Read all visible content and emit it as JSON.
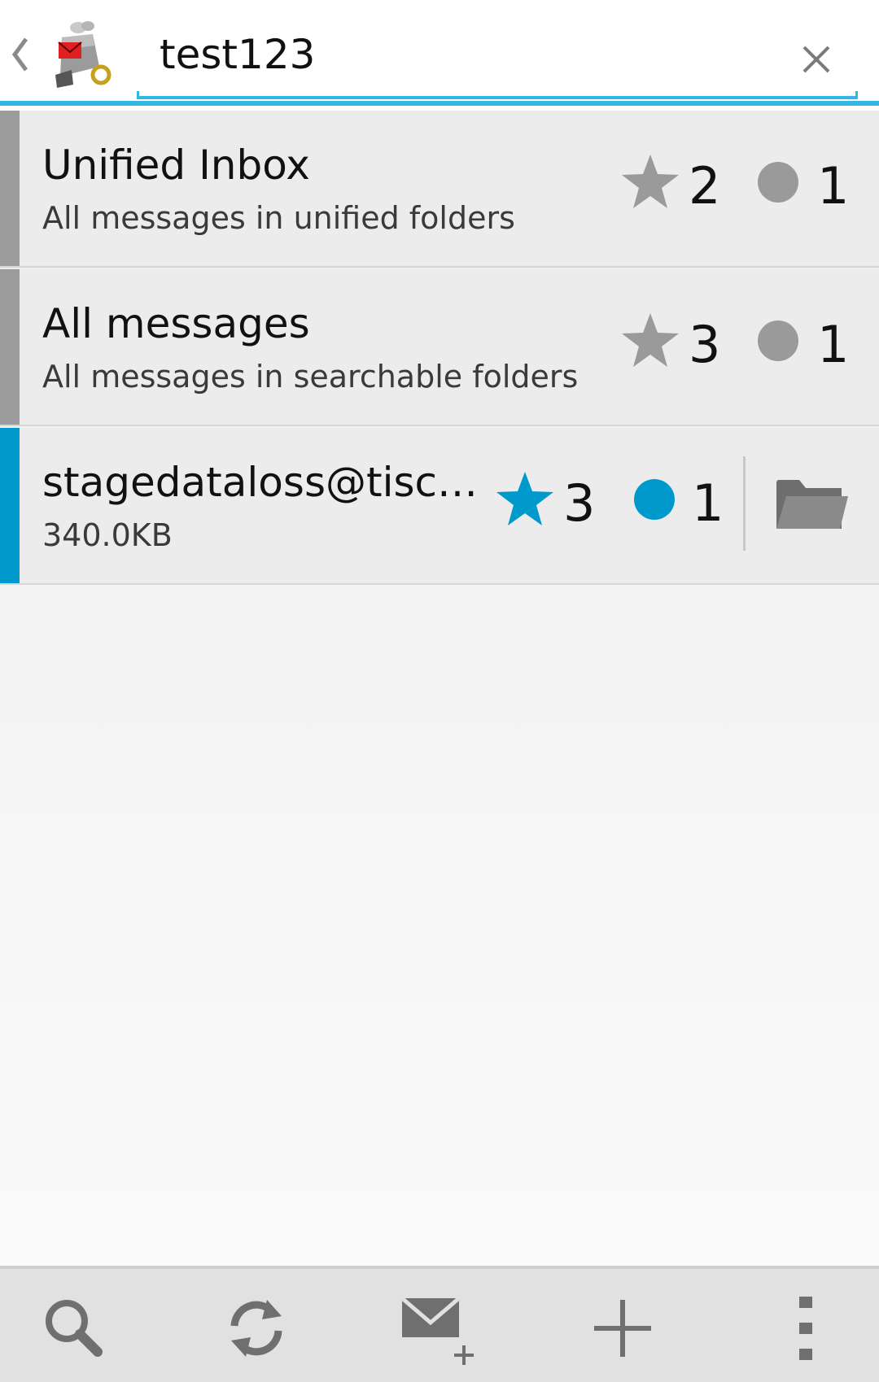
{
  "action_bar": {
    "search": {
      "value": "test123"
    }
  },
  "folders": [
    {
      "title": "Unified Inbox",
      "subtitle": "All messages in unified folders",
      "flagged_count": "2",
      "unread_count": "1"
    },
    {
      "title": "All messages",
      "subtitle": "All messages in searchable folders",
      "flagged_count": "3",
      "unread_count": "1"
    }
  ],
  "account": {
    "title": "stagedataloss@tisc…",
    "subtitle": "340.0KB",
    "flagged_count": "3",
    "unread_count": "1"
  },
  "colors": {
    "accent": "#33b5e5",
    "account_stripe": "#0099cc",
    "account_icons": "#0099cc",
    "neutral_icons": "#9a9a9a"
  },
  "bottom_bar": {
    "icons": [
      "search-icon",
      "refresh-icon",
      "compose-icon",
      "add-icon",
      "overflow-menu-icon"
    ]
  }
}
